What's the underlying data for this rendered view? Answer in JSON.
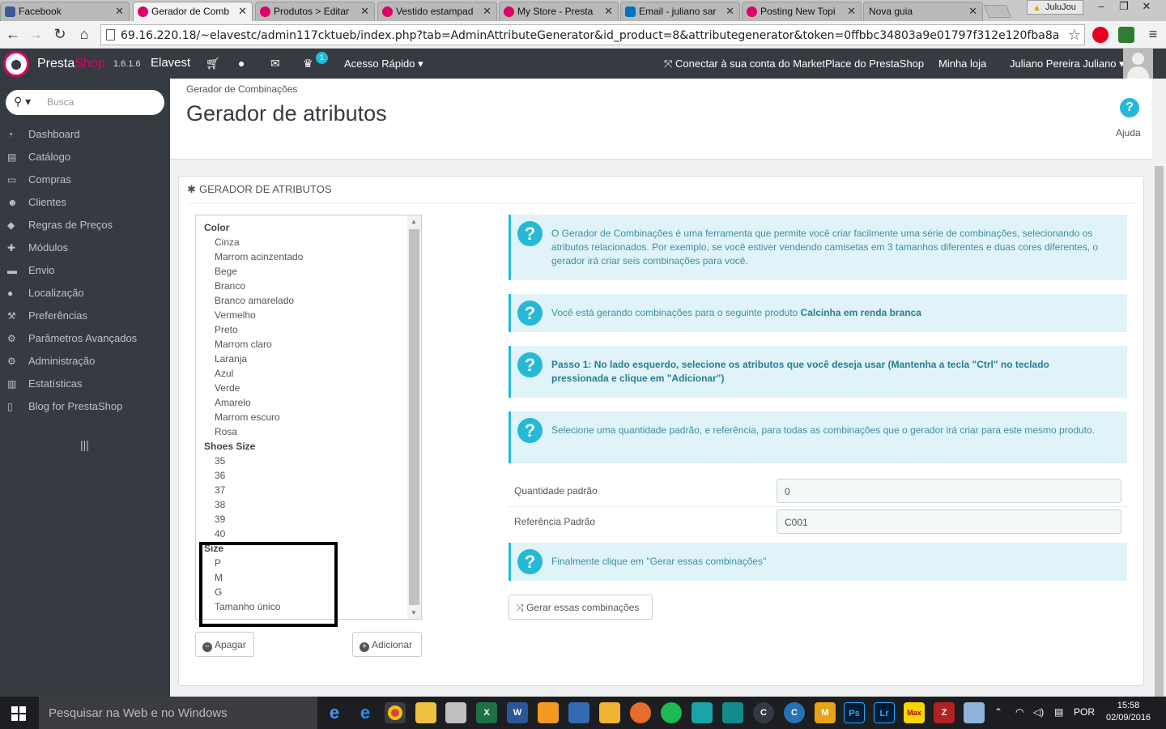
{
  "browser": {
    "tabs": [
      {
        "title": "Facebook",
        "color": "#3b5998"
      },
      {
        "title": "Gerador de Comb",
        "color": "#df0067"
      },
      {
        "title": "Produtos > Editar",
        "color": "#df0067"
      },
      {
        "title": "Vestido estampad",
        "color": "#df0067"
      },
      {
        "title": "My Store - Presta",
        "color": "#df0067"
      },
      {
        "title": "Email - juliano sar",
        "color": "#0072c6"
      },
      {
        "title": "Posting New Topi",
        "color": "#df0067"
      },
      {
        "title": "Nova guia",
        "color": "#ffffff"
      }
    ],
    "profile": "JuluJou",
    "url": "69.16.220.18/~elavestc/admin117cktueb/index.php?tab=AdminAttributeGenerator&id_product=8&attributegenerator&token=0ffbbc34803a9e01797f312e120fba8a"
  },
  "header": {
    "brand_presta": "Presta",
    "brand_shop": "Shop",
    "version": "1.6.1.6",
    "store_name": "Elavest",
    "notification_count": "1",
    "quick_access": "Acesso Rápido",
    "marketplace": "Conectar à sua conta do MarketPlace do PrestaShop",
    "my_store": "Minha loja",
    "user": "Juliano Pereira Juliano"
  },
  "sidebar": {
    "search_placeholder": "Busca",
    "items": [
      {
        "label": "Dashboard",
        "icon": "dashboard-icon"
      },
      {
        "label": "Catálogo",
        "icon": "book-icon"
      },
      {
        "label": "Compras",
        "icon": "credit-card-icon"
      },
      {
        "label": "Clientes",
        "icon": "users-icon"
      },
      {
        "label": "Regras de Preços",
        "icon": "tags-icon"
      },
      {
        "label": "Módulos",
        "icon": "puzzle-icon"
      },
      {
        "label": "Envio",
        "icon": "truck-icon"
      },
      {
        "label": "Localização",
        "icon": "globe-icon"
      },
      {
        "label": "Preferências",
        "icon": "wrench-icon"
      },
      {
        "label": "Parâmetros Avançados",
        "icon": "cogs-icon"
      },
      {
        "label": "Administração",
        "icon": "cog-icon"
      },
      {
        "label": "Estatísticas",
        "icon": "bar-chart-icon"
      },
      {
        "label": "Blog for PrestaShop",
        "icon": "file-icon"
      }
    ]
  },
  "page": {
    "breadcrumb": "Gerador de Combinações",
    "title": "Gerador de atributos",
    "help_label": "Ajuda",
    "panel_title": "Gerador de atributos"
  },
  "attributes": {
    "groups": [
      {
        "name": "Color",
        "values": [
          "Cinza",
          "Marrom acinzentado",
          "Bege",
          "Branco",
          "Branco amarelado",
          "Vermelho",
          "Preto",
          "Marrom claro",
          "Laranja",
          "Azul",
          "Verde",
          "Amarelo",
          "Marrom escuro",
          "Rosa"
        ]
      },
      {
        "name": "Shoes Size",
        "values": [
          "35",
          "36",
          "37",
          "38",
          "39",
          "40"
        ]
      },
      {
        "name": "Size",
        "values": [
          "P",
          "M",
          "G",
          "Tamanho único"
        ]
      }
    ],
    "delete_button": "Apagar",
    "add_button": "Adicionar"
  },
  "alerts": {
    "intro": "O Gerador de Combinações é uma ferramenta que permite você criar facilmente uma série de combinações, selecionando os atributos relacionados. Por exemplo, se você estiver vendendo camisetas em 3 tamanhos diferentes e duas cores diferentes, o gerador irá criar seis combinações para você.",
    "product_prefix": "Você está gerando combinações para o seguinte produto ",
    "product_name": "Calcinha em renda branca",
    "step1": "Passo 1: No lado esquerdo, selecione os atributos que você deseja usar (Mantenha a tecla \"Ctrl\" no teclado pressionada e clique em \"Adicionar\")",
    "defaults": "Selecione uma quantidade padrão, e referência, para todas as combinações que o gerador irá criar para este mesmo produto.",
    "finally": "Finalmente clique em \"Gerar essas combinações\""
  },
  "form": {
    "qty_label": "Quantidade padrão",
    "qty_value": "0",
    "ref_label": "Referência Padrão",
    "ref_value": "C001",
    "generate_button": "Gerar essas combinações"
  },
  "taskbar": {
    "search_placeholder": "Pesquisar na Web e no Windows",
    "language": "POR",
    "time": "15:58",
    "date": "02/09/2016"
  },
  "colors": {
    "accent": "#25b9d7",
    "brand": "#df0067",
    "sidebar": "#363a41"
  }
}
